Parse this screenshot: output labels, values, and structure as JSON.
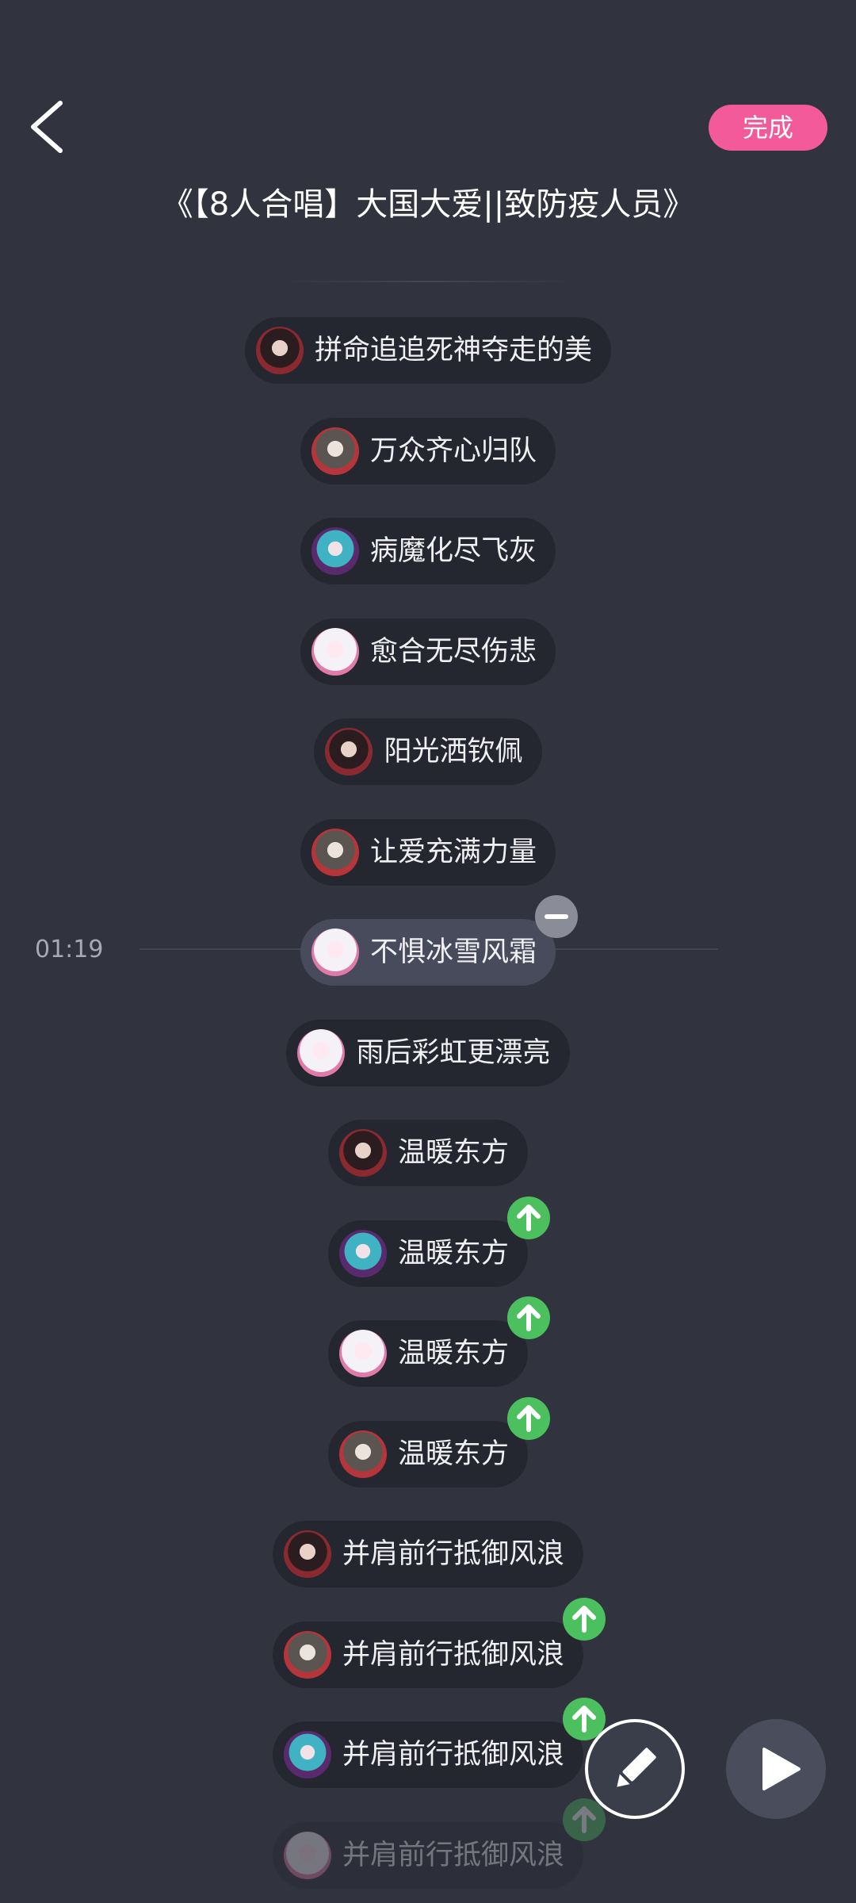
{
  "header": {
    "back_icon": "chevron-left-icon",
    "done_label": "完成",
    "title": "《【8人合唱】大国大爱||致防疫人员》",
    "accent_color": "#f25a9a"
  },
  "playhead": {
    "time": "01:19"
  },
  "lyrics": [
    {
      "text": "拼命追追死神夺走的美",
      "avatar": "avatar-dark-red",
      "badge": ""
    },
    {
      "text": "万众齐心归队",
      "avatar": "avatar-grey-red",
      "badge": ""
    },
    {
      "text": "病魔化尽飞灰",
      "avatar": "avatar-teal-purple",
      "badge": ""
    },
    {
      "text": "愈合无尽伤悲",
      "avatar": "avatar-pink-white",
      "badge": ""
    },
    {
      "text": "阳光洒钦佩",
      "avatar": "avatar-dark-red",
      "badge": ""
    },
    {
      "text": "让爱充满力量",
      "avatar": "avatar-grey-red",
      "badge": ""
    },
    {
      "text": "不惧冰雪风霜",
      "avatar": "avatar-pink-white",
      "badge": "minus",
      "active": true
    },
    {
      "text": "雨后彩虹更漂亮",
      "avatar": "avatar-pink-white",
      "badge": ""
    },
    {
      "text": "温暖东方",
      "avatar": "avatar-dark-red",
      "badge": ""
    },
    {
      "text": "温暖东方",
      "avatar": "avatar-teal-purple",
      "badge": "up"
    },
    {
      "text": "温暖东方",
      "avatar": "avatar-pink-white",
      "badge": "up"
    },
    {
      "text": "温暖东方",
      "avatar": "avatar-grey-red",
      "badge": "up"
    },
    {
      "text": "并肩前行抵御风浪",
      "avatar": "avatar-dark-red",
      "badge": ""
    },
    {
      "text": "并肩前行抵御风浪",
      "avatar": "avatar-grey-red",
      "badge": "up"
    },
    {
      "text": "并肩前行抵御风浪",
      "avatar": "avatar-teal-purple",
      "badge": "up"
    },
    {
      "text": "并肩前行抵御风浪",
      "avatar": "avatar-pink-white",
      "badge": "up",
      "faded": true
    }
  ],
  "controls": {
    "edit_icon": "pencil-icon",
    "play_icon": "play-icon"
  },
  "colors": {
    "background": "#31333f",
    "pill": "#252730",
    "pill_active": "#474b5c",
    "up_badge": "#4cbf5e",
    "minus_badge": "#8a8d98"
  }
}
